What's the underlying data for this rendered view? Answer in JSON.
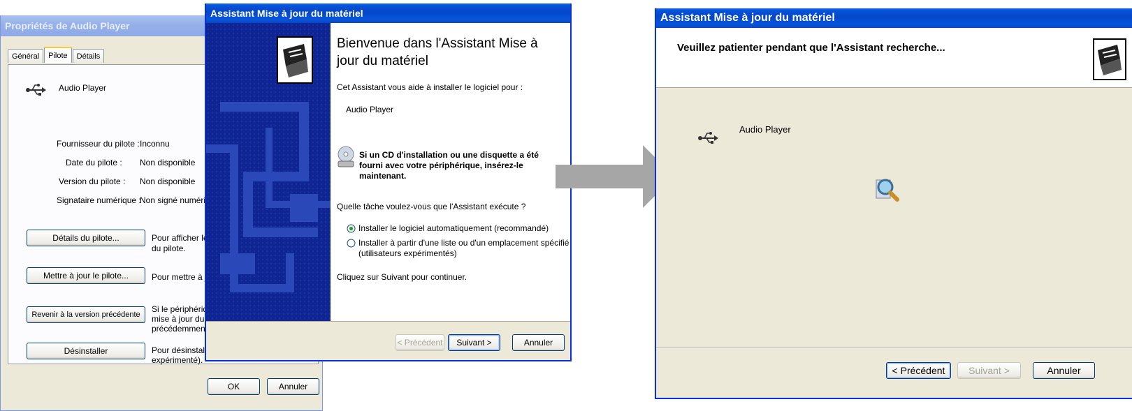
{
  "properties_window": {
    "title": "Propriétés de Audio Player",
    "tabs": [
      "Général",
      "Pilote",
      "Détails"
    ],
    "device_name": "Audio Player",
    "rows": [
      {
        "label": "Fournisseur du pilote :",
        "value": "Inconnu"
      },
      {
        "label": "Date du pilote :",
        "value": "Non disponible"
      },
      {
        "label": "Version du pilote :",
        "value": "Non disponible"
      },
      {
        "label": "Signataire numérique :",
        "value": "Non signé numériqu"
      }
    ],
    "actions": [
      {
        "button": "Détails du pilote...",
        "desc_lines": [
          "Pour afficher les",
          "du pilote."
        ]
      },
      {
        "button": "Mettre à jour le pilote...",
        "desc_lines": [
          "Pour mettre à jou"
        ]
      },
      {
        "button": "Revenir à la version précédente",
        "desc_lines": [
          "Si le périphérique",
          "mise à jour du pil",
          "précédemment in"
        ]
      },
      {
        "button": "Désinstaller",
        "desc_lines": [
          "Pour désinstaller",
          "expérimenté)."
        ]
      }
    ],
    "ok_label": "OK",
    "cancel_label": "Annuler"
  },
  "wizard_welcome": {
    "title": "Assistant Mise à jour du matériel",
    "heading_lines": [
      "Bienvenue dans l'Assistant Mise à",
      "jour du matériel"
    ],
    "intro": "Cet Assistant vous aide à installer le logiciel pour :",
    "device": "Audio Player",
    "cd_notice_lines": [
      "Si un CD d'installation ou une disquette a été",
      "fourni avec votre périphérique, insérez-le",
      "maintenant."
    ],
    "question": "Quelle tâche voulez-vous que l'Assistant exécute ?",
    "option_auto": "Installer le logiciel automatiquement (recommandé)",
    "option_list_lines": [
      "Installer à partir d'une liste ou d'un emplacement spécifié",
      "(utilisateurs expérimentés)"
    ],
    "continue_text": "Cliquez sur Suivant pour continuer.",
    "back_label": "< Précédent",
    "next_label": "Suivant >",
    "cancel_label": "Annuler"
  },
  "wizard_search": {
    "title": "Assistant Mise à jour du matériel",
    "header_text": "Veuillez patienter pendant que l'Assistant recherche...",
    "device": "Audio Player",
    "back_label": "< Précédent",
    "next_label": "Suivant >",
    "cancel_label": "Annuler"
  },
  "colors": {
    "titlebar_blue": "#0447c9",
    "window_face": "#ece9d8",
    "banner_navy": "#0f2593",
    "arrow_gray": "#a6a6a6"
  }
}
